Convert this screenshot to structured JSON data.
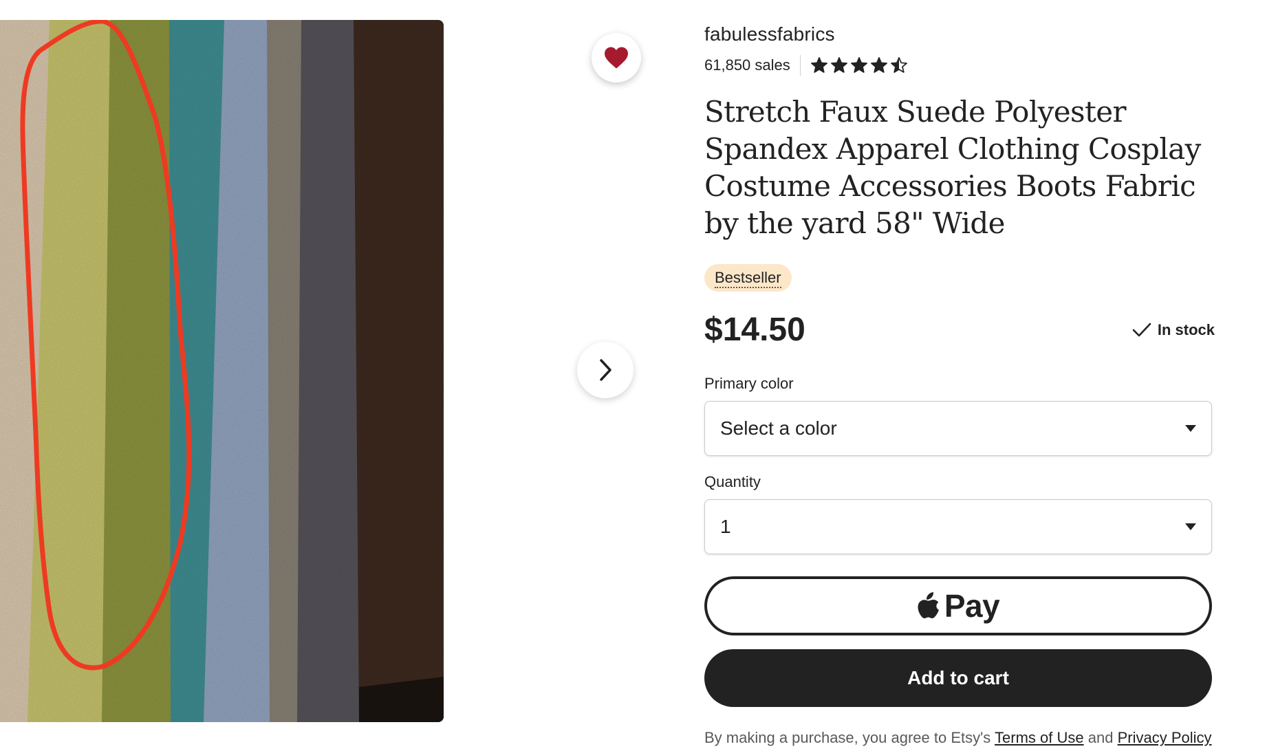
{
  "shop": {
    "name": "fabulessfabrics",
    "sales": "61,850 sales",
    "rating": 4.5,
    "rating_max": 5
  },
  "listing": {
    "title": "Stretch Faux Suede Polyester Spandex Apparel Clothing Cosplay Costume Accessories Boots Fabric by the yard 58\" Wide",
    "badge": "Bestseller",
    "price": "$14.50",
    "stock": "In stock"
  },
  "image_panel": {
    "favorited": true,
    "heart_color": "#a61a2e",
    "next_icon": "chevron-right-icon",
    "swatch_colors": [
      "#dccab0",
      "#c9c56e",
      "#8e963f",
      "#3f8f94",
      "#94a6c2",
      "#8a8276",
      "#56545a",
      "#3e2a20"
    ],
    "annotation_color": "#ee3a22"
  },
  "options": {
    "color_label": "Primary color",
    "color_value": "Select a color",
    "quantity_label": "Quantity",
    "quantity_value": "1"
  },
  "actions": {
    "apple_pay_label": "Pay",
    "add_to_cart_label": "Add to cart"
  },
  "legal": {
    "prefix": "By making a purchase, you agree to Etsy's",
    "terms_link": "Terms of Use",
    "and": "and",
    "privacy_link": "Privacy Policy"
  }
}
